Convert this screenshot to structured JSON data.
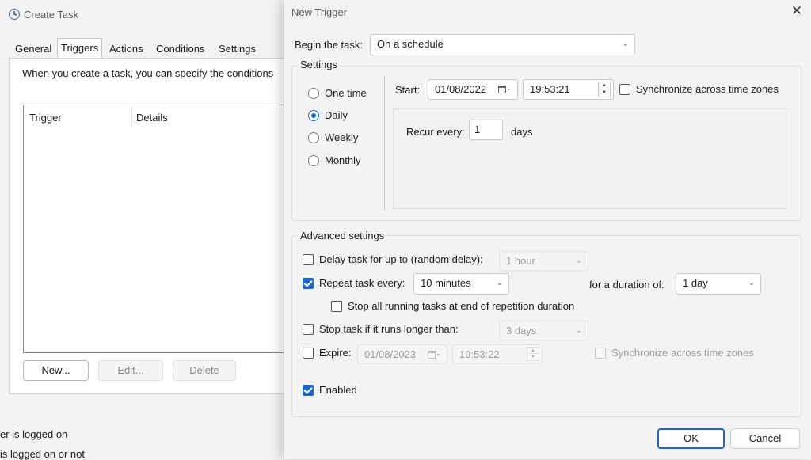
{
  "create_task": {
    "title": "Create Task",
    "tabs": [
      "General",
      "Triggers",
      "Actions",
      "Conditions",
      "Settings"
    ],
    "description": "When you create a task, you can specify the conditions",
    "columns": [
      "Trigger",
      "Details"
    ],
    "buttons": {
      "new": "New...",
      "edit": "Edit...",
      "delete": "Delete"
    },
    "background_text": [
      "er is logged on",
      "is logged on or not"
    ]
  },
  "new_trigger": {
    "title": "New Trigger",
    "begin_label": "Begin the task:",
    "begin_value": "On a schedule",
    "settings": {
      "legend": "Settings",
      "radios": [
        {
          "label": "One time",
          "selected": false
        },
        {
          "label": "Daily",
          "selected": true
        },
        {
          "label": "Weekly",
          "selected": false
        },
        {
          "label": "Monthly",
          "selected": false
        }
      ],
      "start_label": "Start:",
      "start_date": "01/08/2022",
      "start_time": "19:53:21",
      "sync_label": "Synchronize across time zones",
      "sync_checked": false,
      "recur_label": "Recur every:",
      "recur_value": "1",
      "recur_unit": "days"
    },
    "advanced": {
      "legend": "Advanced settings",
      "delay_label": "Delay task for up to (random delay):",
      "delay_value": "1 hour",
      "delay_checked": false,
      "repeat_label": "Repeat task every:",
      "repeat_value": "10 minutes",
      "repeat_checked": true,
      "duration_label": "for a duration of:",
      "duration_value": "1 day",
      "stop_all_label": "Stop all running tasks at end of repetition duration",
      "stop_all_checked": false,
      "stop_longer_label": "Stop task if it runs longer than:",
      "stop_longer_value": "3 days",
      "stop_longer_checked": false,
      "expire_label": "Expire:",
      "expire_date": "01/08/2023",
      "expire_time": "19:53:22",
      "expire_checked": false,
      "expire_sync_label": "Synchronize across time zones",
      "enabled_label": "Enabled",
      "enabled_checked": true
    },
    "buttons": {
      "ok": "OK",
      "cancel": "Cancel"
    }
  },
  "colors": {
    "accent": "#1a66c9",
    "window_bg": "#f3f3f3",
    "disabled_text": "#9a9a9a"
  }
}
